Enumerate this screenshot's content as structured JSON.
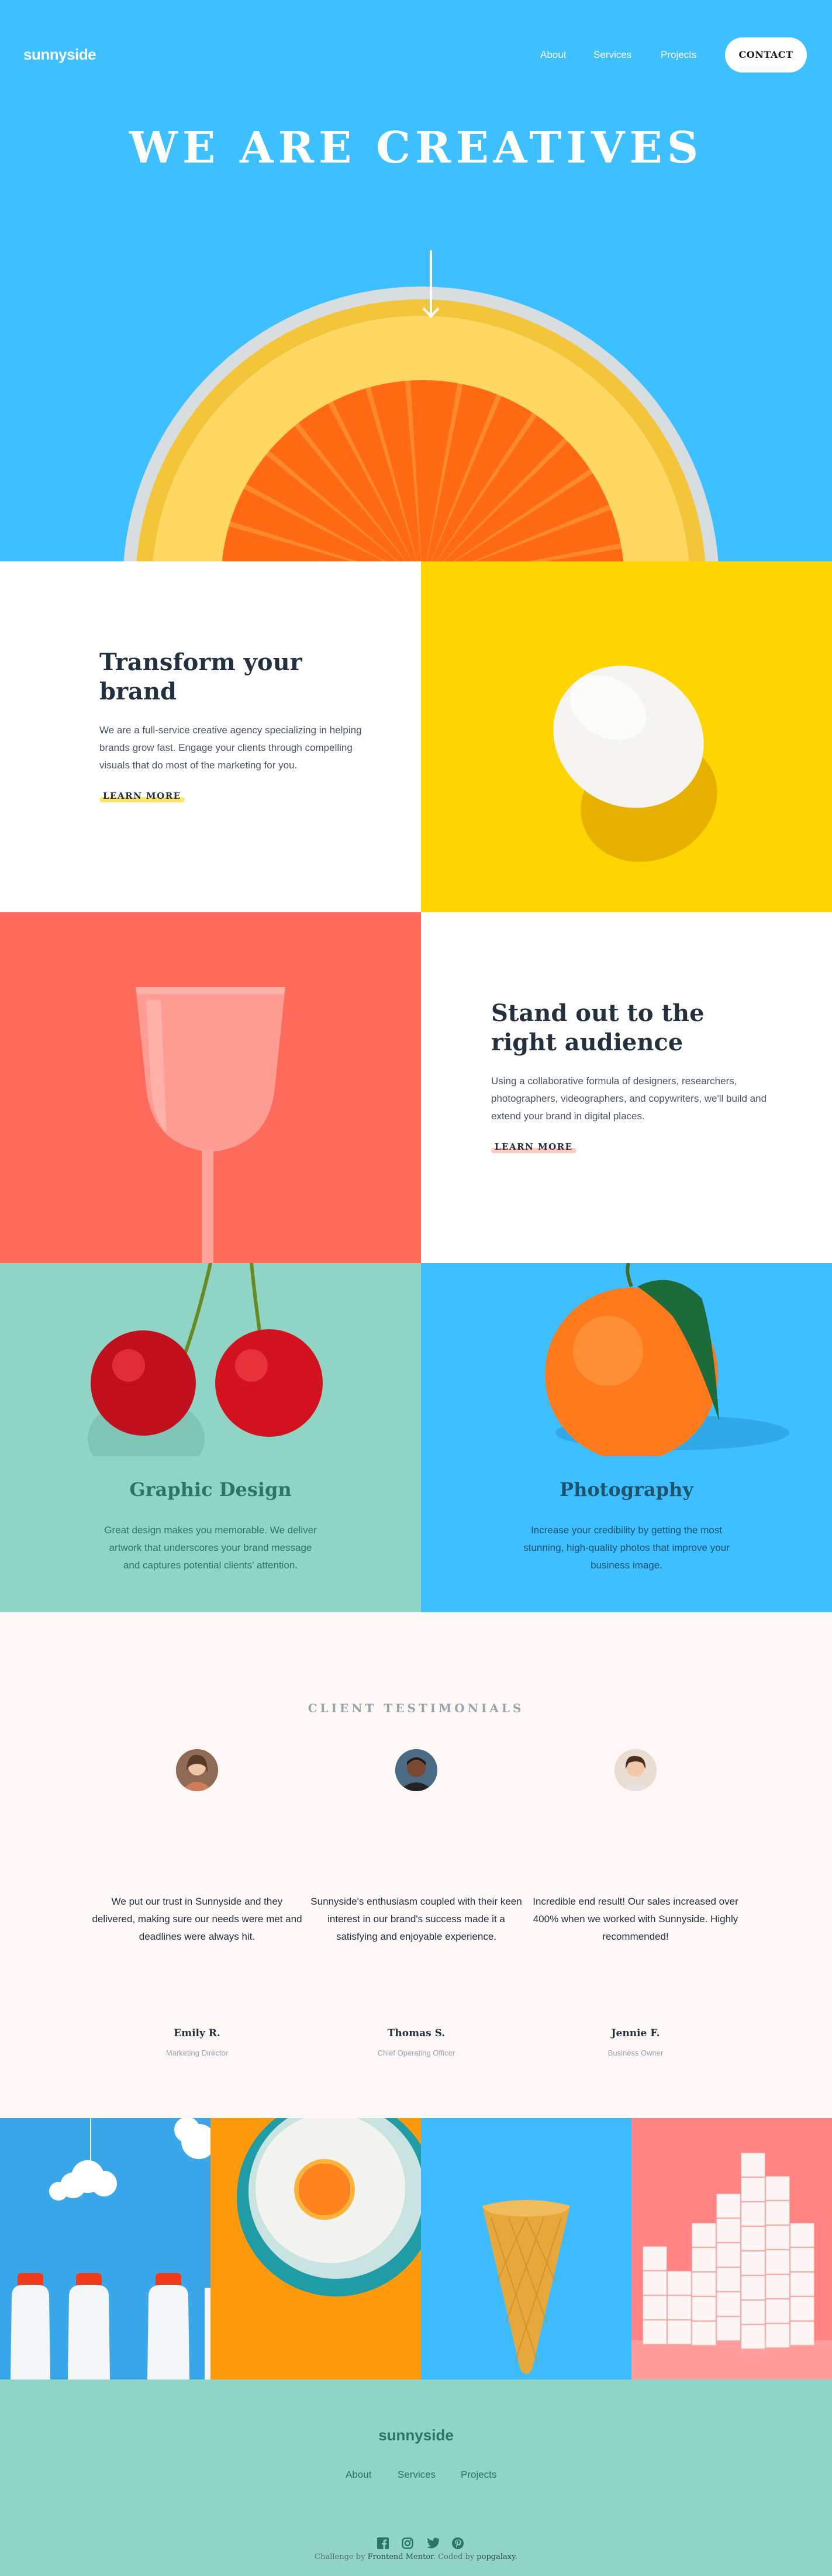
{
  "header": {
    "logo": "sunnyside",
    "nav": [
      "About",
      "Services",
      "Projects"
    ],
    "contact": "CONTACT"
  },
  "hero": {
    "title": "WE ARE CREATIVES"
  },
  "transform": {
    "title": "Transform your brand",
    "text": "We are a full-service creative agency specializing in helping brands grow fast. Engage your clients through compelling visuals that do most of the marketing for you.",
    "link": "LEARN MORE",
    "accent": "#fed500"
  },
  "standout": {
    "title": "Stand out to the right audience",
    "text": "Using a collaborative formula of designers, researchers, photographers, videographers, and copywriters, we'll build and extend your brand in digital places.",
    "link": "LEARN MORE",
    "accent": "#ffa79a"
  },
  "graphic": {
    "title": "Graphic Design",
    "text": "Great design makes you memorable. We deliver artwork that underscores your brand message and captures potential clients' attention.",
    "color": "#2c7566"
  },
  "photo": {
    "title": "Photography",
    "text": "Increase your credibility by getting the most stunning, high-quality photos that improve your business image.",
    "color": "#1d536c"
  },
  "testimonials": {
    "heading": "CLIENT TESTIMONIALS",
    "people": [
      {
        "quote": "We put our trust in Sunnyside and they delivered, making sure our needs were met and deadlines were always hit.",
        "name": "Emily R.",
        "role": "Marketing Director"
      },
      {
        "quote": "Sunnyside's enthusiasm coupled with their keen interest in our brand's success made it a satisfying and enjoyable experience.",
        "name": "Thomas S.",
        "role": "Chief Operating Officer"
      },
      {
        "quote": "Incredible end result! Our sales increased over 400% when we worked with Sunnyside. Highly recommended!",
        "name": "Jennie F.",
        "role": "Business Owner"
      }
    ]
  },
  "footer": {
    "logo": "sunnyside",
    "nav": [
      "About",
      "Services",
      "Projects"
    ],
    "social": [
      "facebook-icon",
      "instagram-icon",
      "twitter-icon",
      "pinterest-icon"
    ],
    "credit_prefix": "Challenge by",
    "credit_challenge": "Frontend Mentor",
    "credit_mid": ". Coded by",
    "credit_author": "popgalaxy",
    "credit_suffix": "."
  }
}
